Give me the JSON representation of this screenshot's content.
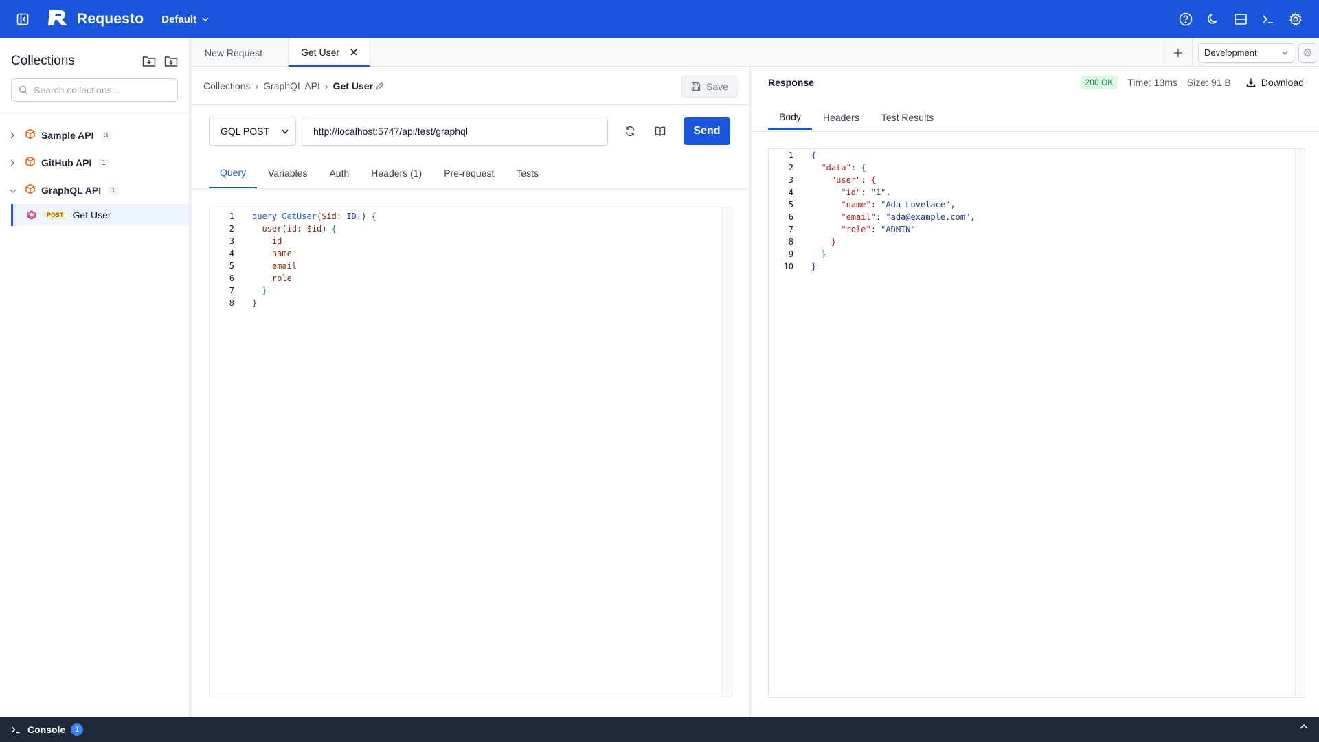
{
  "app": {
    "name": "Requesto",
    "workspace": "Default"
  },
  "sidebar": {
    "title": "Collections",
    "search_placeholder": "Search collections...",
    "collections": [
      {
        "name": "Sample API",
        "count": "3"
      },
      {
        "name": "GitHub API",
        "count": "1"
      },
      {
        "name": "GraphQL API",
        "count": "1"
      }
    ],
    "active_request": {
      "method": "POST",
      "name": "Get User"
    }
  },
  "tabs": [
    {
      "label": "New Request"
    },
    {
      "label": "Get User"
    }
  ],
  "environment": "Development",
  "breadcrumb": [
    "Collections",
    "GraphQL API",
    "Get User"
  ],
  "save_label": "Save",
  "request": {
    "method": "GQL POST",
    "url": "http://localhost:5747/api/test/graphql",
    "send_label": "Send",
    "subtabs": [
      "Query",
      "Variables",
      "Auth",
      "Headers (1)",
      "Pre-request",
      "Tests"
    ]
  },
  "query_lines": [
    "query GetUser($id: ID!) {",
    "  user(id: $id) {",
    "    id",
    "    name",
    "    email",
    "    role",
    "  }",
    "}"
  ],
  "response": {
    "title": "Response",
    "status": "200 OK",
    "time": "Time: 13ms",
    "size": "Size: 91 B",
    "download_label": "Download",
    "tabs": [
      "Body",
      "Headers",
      "Test Results"
    ],
    "body_lines": [
      "{",
      "  \"data\": {",
      "    \"user\": {",
      "      \"id\": \"1\",",
      "      \"name\": \"Ada Lovelace\",",
      "      \"email\": \"ada@example.com\",",
      "      \"role\": \"ADMIN\"",
      "    }",
      "  }",
      "}"
    ]
  },
  "console": {
    "label": "Console",
    "count": "1"
  },
  "colors": {
    "accent": "#1a56db",
    "status_ok_bg": "#dcfce7",
    "status_ok_text": "#15803d"
  }
}
